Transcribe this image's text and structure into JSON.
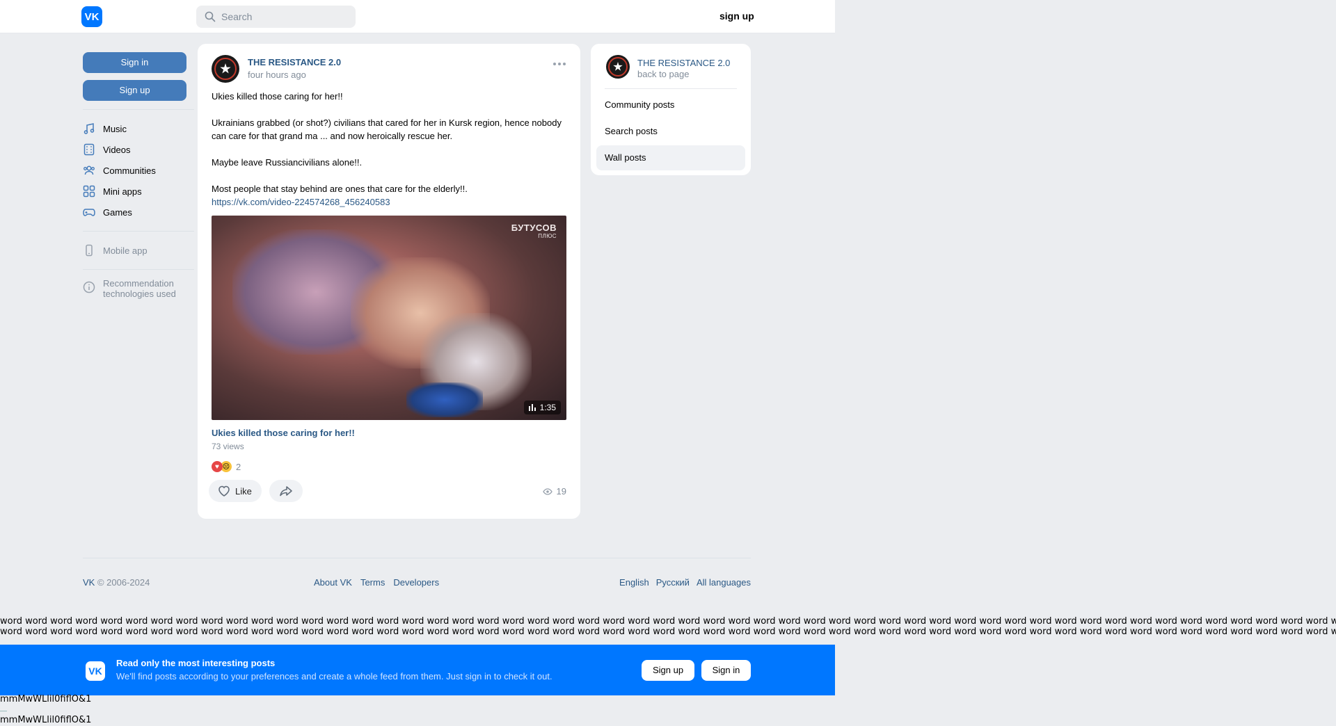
{
  "header": {
    "logo": "VK",
    "search_placeholder": "Search",
    "signup": "sign up"
  },
  "left": {
    "sign_in": "Sign in",
    "sign_up": "Sign up",
    "nav": [
      {
        "label": "Music",
        "icon": "music-icon"
      },
      {
        "label": "Videos",
        "icon": "video-icon"
      },
      {
        "label": "Communities",
        "icon": "users-icon"
      },
      {
        "label": "Mini apps",
        "icon": "apps-icon"
      },
      {
        "label": "Games",
        "icon": "gamepad-icon"
      }
    ],
    "mobile_app": "Mobile app",
    "recommendation": "Recommendation technologies used"
  },
  "post": {
    "author": "THE RESISTANCE 2.0",
    "time": "four hours ago",
    "paragraphs": [
      "Ukies killed those caring for her!!",
      "Ukrainians grabbed (or shot?) civilians that cared for her in Kursk region, hence nobody can care for that grand ma ... and now heroically rescue her.",
      "Maybe leave Russiancivilians alone!!.",
      "Most people that stay behind are ones that care for the elderly!!."
    ],
    "link": "https://vk.com/video-224574268_456240583",
    "video": {
      "watermark": "БУТУСОВ",
      "watermark_sub": "ПЛЮС",
      "duration": "1:35",
      "title": "Ukies killed those caring for her!!",
      "views": "73 views"
    },
    "reactions_count": "2",
    "like_label": "Like",
    "views_count": "19"
  },
  "right": {
    "name": "THE RESISTANCE 2.0",
    "back": "back to page",
    "items": [
      "Community posts",
      "Search posts",
      "Wall posts"
    ]
  },
  "footer": {
    "vk": "VK",
    "copy": " © 2006-2024",
    "links": [
      "About VK",
      "Terms",
      "Developers"
    ],
    "langs": [
      "English",
      "Русский",
      "All languages"
    ]
  },
  "filler_words": "word word word word word word word word word word word word word word word word word word word word word word word word word word word word word word word word word word word word word word word word word word word word word word word word word word word word word word word word word word word word word word word word word word",
  "banner": {
    "logo": "VK",
    "title": "Read only the most interesting posts",
    "subtitle": "We'll find posts according to your preferences and create a whole feed from them. Just sign in to check it out.",
    "signup": "Sign up",
    "signin": "Sign in"
  },
  "bottom_text": "mmMwWLlil0fiflO&1",
  "colors": {
    "accent": "#0077ff",
    "link": "#2a5885",
    "button": "#447bba",
    "background": "#ebedf0"
  }
}
